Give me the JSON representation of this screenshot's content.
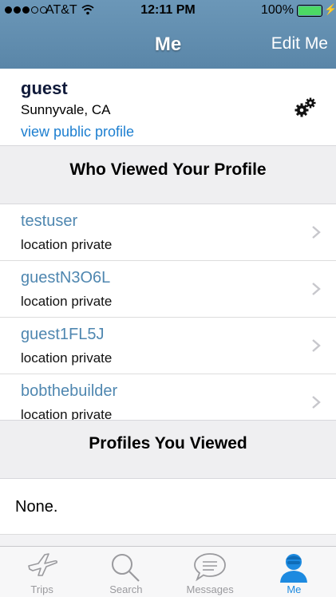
{
  "status": {
    "carrier": "AT&T",
    "time": "12:11 PM",
    "battery": "100%",
    "signal_bars_filled": 3,
    "signal_bars_total": 5
  },
  "nav": {
    "title": "Me",
    "edit_label": "Edit Me"
  },
  "profile": {
    "name": "guest",
    "location": "Sunnyvale, CA",
    "link": "view public profile"
  },
  "sections": {
    "viewed_you": "Who Viewed Your Profile",
    "you_viewed": "Profiles You Viewed"
  },
  "viewers": [
    {
      "name": "testuser",
      "location": "location private"
    },
    {
      "name": "guestN3O6L",
      "location": "location private"
    },
    {
      "name": "guest1FL5J",
      "location": "location private"
    },
    {
      "name": "bobthebuilder",
      "location": "location private"
    }
  ],
  "viewed_empty": "None.",
  "tabs": [
    {
      "label": "Trips",
      "icon": "airplane-icon"
    },
    {
      "label": "Search",
      "icon": "search-icon"
    },
    {
      "label": "Messages",
      "icon": "chat-bubble-icon"
    },
    {
      "label": "Me",
      "icon": "person-icon",
      "active": true
    }
  ],
  "colors": {
    "nav_bar": "#5a86a8",
    "link": "#1d7fd0",
    "username": "#4f87b0",
    "active_tab": "#1d8ae0",
    "battery": "#4cd964"
  }
}
